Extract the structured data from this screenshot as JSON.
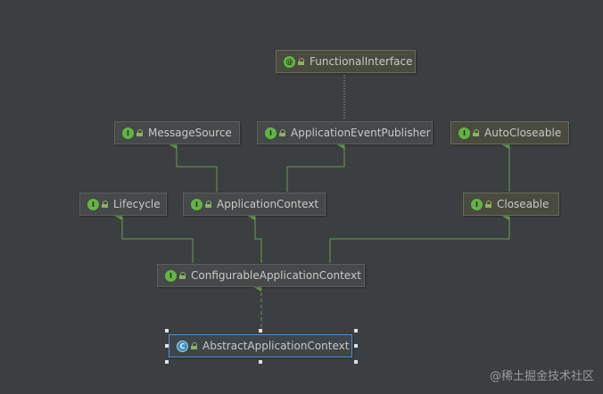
{
  "nodes": {
    "functional_interface": {
      "kind": "@",
      "label": "FunctionalInterface"
    },
    "message_source": {
      "kind": "I",
      "label": "MessageSource"
    },
    "application_event_publisher": {
      "kind": "I",
      "label": "ApplicationEventPublisher"
    },
    "auto_closeable": {
      "kind": "I",
      "label": "AutoCloseable"
    },
    "lifecycle": {
      "kind": "I",
      "label": "Lifecycle"
    },
    "application_context": {
      "kind": "I",
      "label": "ApplicationContext"
    },
    "closeable": {
      "kind": "I",
      "label": "Closeable"
    },
    "configurable_application_context": {
      "kind": "I",
      "label": "ConfigurableApplicationContext"
    },
    "abstract_application_context": {
      "kind": "C",
      "label": "AbstractApplicationContext"
    }
  },
  "colors": {
    "background": "#3c3f41",
    "extends_arrow": "#6a9955",
    "interface_badge": "#62b543",
    "class_badge": "#3d8fbf",
    "selection": "#4f8fd0"
  },
  "watermark": "@稀土掘金技术社区"
}
